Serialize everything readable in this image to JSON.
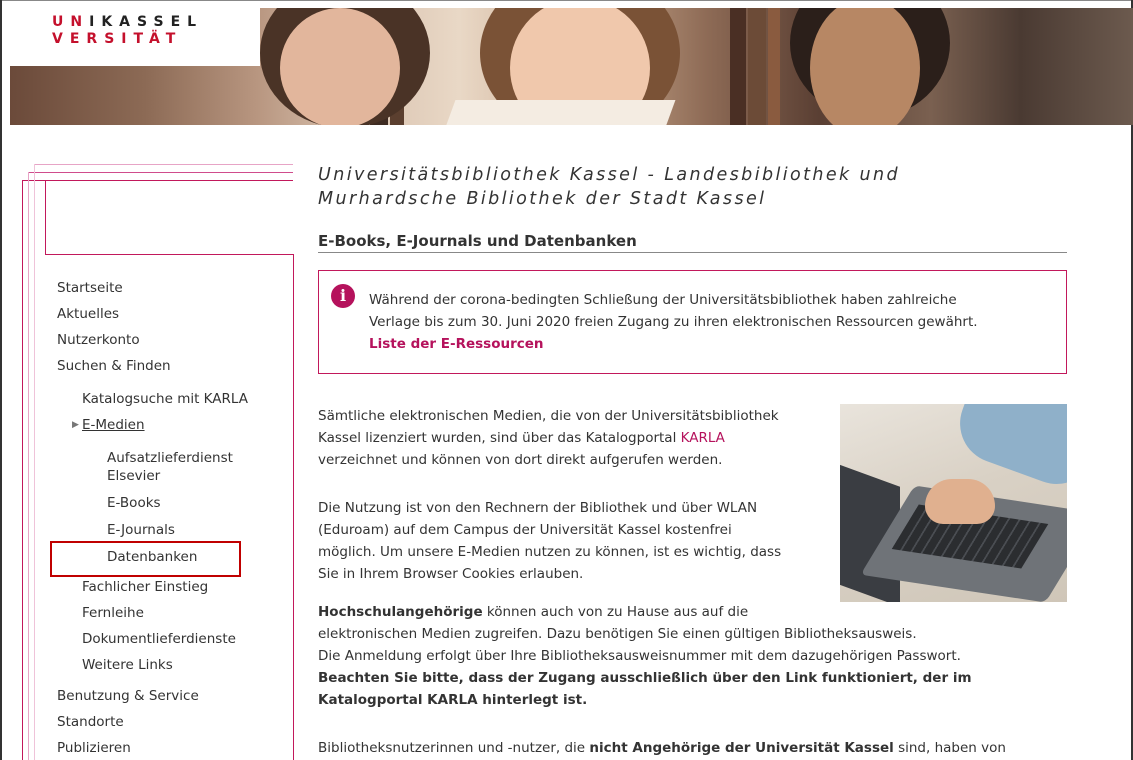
{
  "logo": {
    "row1": [
      "U",
      "N",
      "I",
      "K",
      "A",
      "S",
      "S",
      "E",
      "L"
    ],
    "row2": [
      "V",
      "E",
      "R",
      "S",
      "I",
      "T",
      "Ä",
      "T"
    ],
    "alt": "UNIKASSEL VERSITÄT"
  },
  "header": {
    "institution_line1": "Universitätsbibliothek Kassel - Landesbibliothek und",
    "institution_line2": "Murhardsche Bibliothek der Stadt Kassel",
    "page_title": "E-Books, E-Journals und Datenbanken"
  },
  "nav": {
    "items": [
      {
        "label": "Startseite"
      },
      {
        "label": "Aktuelles"
      },
      {
        "label": "Nutzerkonto"
      },
      {
        "label": "Suchen & Finden"
      },
      {
        "label": "Katalogsuche mit KARLA"
      },
      {
        "label": "E-Medien"
      },
      {
        "label": "Aufsatzlieferdienst"
      },
      {
        "label": "Elsevier"
      },
      {
        "label": "E-Books"
      },
      {
        "label": "E-Journals"
      },
      {
        "label": "Datenbanken"
      },
      {
        "label": "Fachlicher Einstieg"
      },
      {
        "label": "Fernleihe"
      },
      {
        "label": "Dokumentlieferdienste"
      },
      {
        "label": "Weitere Links"
      },
      {
        "label": "Benutzung & Service"
      },
      {
        "label": "Standorte"
      },
      {
        "label": "Publizieren"
      }
    ]
  },
  "notice": {
    "line1": "Während der corona-bedingten Schließung der Universitätsbibliothek haben zahlreiche",
    "line2": "Verlage bis zum 30. Juni 2020 freien Zugang zu ihren elektronischen Ressourcen gewährt.",
    "link": "Liste der E-Ressourcen"
  },
  "content": {
    "p1_a": "Sämtliche elektronischen Medien, die von der Universitätsbibliothek",
    "p1_b": "Kassel lizenziert wurden, sind über das Katalogportal ",
    "p1_link": "KARLA",
    "p1_c": "verzeichnet und können von dort direkt aufgerufen werden.",
    "p2_a": "Die Nutzung ist von den Rechnern der Bibliothek und über WLAN",
    "p2_b": "(Eduroam) auf dem Campus der Universität Kassel kostenfrei",
    "p2_c": "möglich. Um unsere E-Medien nutzen zu können, ist es wichtig, dass",
    "p2_d": "Sie in Ihrem Browser Cookies erlauben.",
    "p3_bold": "Hochschulangehörige",
    "p3_a": " können auch von zu Hause aus auf die",
    "p3_b": "elektronischen Medien zugreifen. Dazu benötigen Sie einen gültigen Bibliotheksausweis.",
    "p3_c": "Die Anmeldung erfolgt über Ihre Bibliotheksausweisnummer mit dem dazugehörigen Passwort.",
    "p3_d": "Beachten Sie bitte, dass der Zugang ausschließlich über den Link funktioniert, der im",
    "p3_e": "Katalogportal KARLA hinterlegt ist.",
    "p4_a": "Bibliotheksnutzerinnen und -nutzer, die ",
    "p4_bold": "nicht Angehörige der Universität Kassel",
    "p4_b": " sind, haben von"
  },
  "colors": {
    "accent": "#b5125c",
    "selection_box": "#c00000",
    "logo_red": "#c4102c"
  }
}
